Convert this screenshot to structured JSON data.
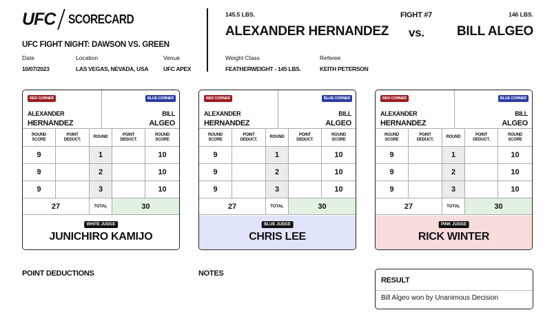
{
  "header": {
    "logo": "UFC",
    "title": "SCORECARD",
    "event": "UFC FIGHT NIGHT: DAWSON VS. GREEN",
    "date_label": "Date",
    "date": "10/07/2023",
    "location_label": "Location",
    "location": "LAS VEGAS, NEVADA, USA",
    "venue_label": "Venue",
    "venue": "UFC APEX",
    "weight_class_label": "Weight Class",
    "weight_class": "FEATHERWEIGHT - 145 LBS.",
    "referee_label": "Referee",
    "referee": "KEITH PETERSON"
  },
  "bout": {
    "fight_number": "FIGHT #7",
    "vs": "vs.",
    "red_fighter": "ALEXANDER HERNANDEZ",
    "red_weight": "145.5 LBS.",
    "blue_fighter": "BILL ALGEO",
    "blue_weight": "146 LBS."
  },
  "card_labels": {
    "red_corner": "RED CORNER",
    "blue_corner": "BLUE CORNER",
    "red_first": "ALEXANDER",
    "red_last": "HERNANDEZ",
    "blue_first": "BILL",
    "blue_last": "ALGEO",
    "round_score_1": "ROUND",
    "round_score_2": "SCORE",
    "point_deduct_1": "POINT",
    "point_deduct_2": "DEDUCT.",
    "round": "ROUND",
    "total": "TOTAL"
  },
  "cards": [
    {
      "judge_tag": "WHITE JUDGE",
      "judge_name": "JUNICHIRO KAMIJO",
      "judge_color": "#ffffff",
      "rounds": [
        {
          "round": "1",
          "red_score": "9",
          "red_deduct": "",
          "blue_deduct": "",
          "blue_score": "10"
        },
        {
          "round": "2",
          "red_score": "9",
          "red_deduct": "",
          "blue_deduct": "",
          "blue_score": "10"
        },
        {
          "round": "3",
          "red_score": "9",
          "red_deduct": "",
          "blue_deduct": "",
          "blue_score": "10"
        }
      ],
      "red_total": "27",
      "blue_total": "30"
    },
    {
      "judge_tag": "BLUE JUDGE",
      "judge_name": "CHRIS LEE",
      "judge_color": "#e1e5fb",
      "rounds": [
        {
          "round": "1",
          "red_score": "9",
          "red_deduct": "",
          "blue_deduct": "",
          "blue_score": "10"
        },
        {
          "round": "2",
          "red_score": "9",
          "red_deduct": "",
          "blue_deduct": "",
          "blue_score": "10"
        },
        {
          "round": "3",
          "red_score": "9",
          "red_deduct": "",
          "blue_deduct": "",
          "blue_score": "10"
        }
      ],
      "red_total": "27",
      "blue_total": "30"
    },
    {
      "judge_tag": "PINK JUDGE",
      "judge_name": "RICK WINTER",
      "judge_color": "#f8dcdc",
      "rounds": [
        {
          "round": "1",
          "red_score": "9",
          "red_deduct": "",
          "blue_deduct": "",
          "blue_score": "10"
        },
        {
          "round": "2",
          "red_score": "9",
          "red_deduct": "",
          "blue_deduct": "",
          "blue_score": "10"
        },
        {
          "round": "3",
          "red_score": "9",
          "red_deduct": "",
          "blue_deduct": "",
          "blue_score": "10"
        }
      ],
      "red_total": "27",
      "blue_total": "30"
    }
  ],
  "footer": {
    "point_deductions_title": "POINT DEDUCTIONS",
    "notes_title": "NOTES",
    "result_title": "RESULT",
    "result_text": "Bill Algeo won by Unanimous Decision"
  },
  "colors": {
    "red_corner": "#9b1b1f",
    "blue_corner": "#2d3aa6",
    "winner_total": "#e3f1e3"
  }
}
